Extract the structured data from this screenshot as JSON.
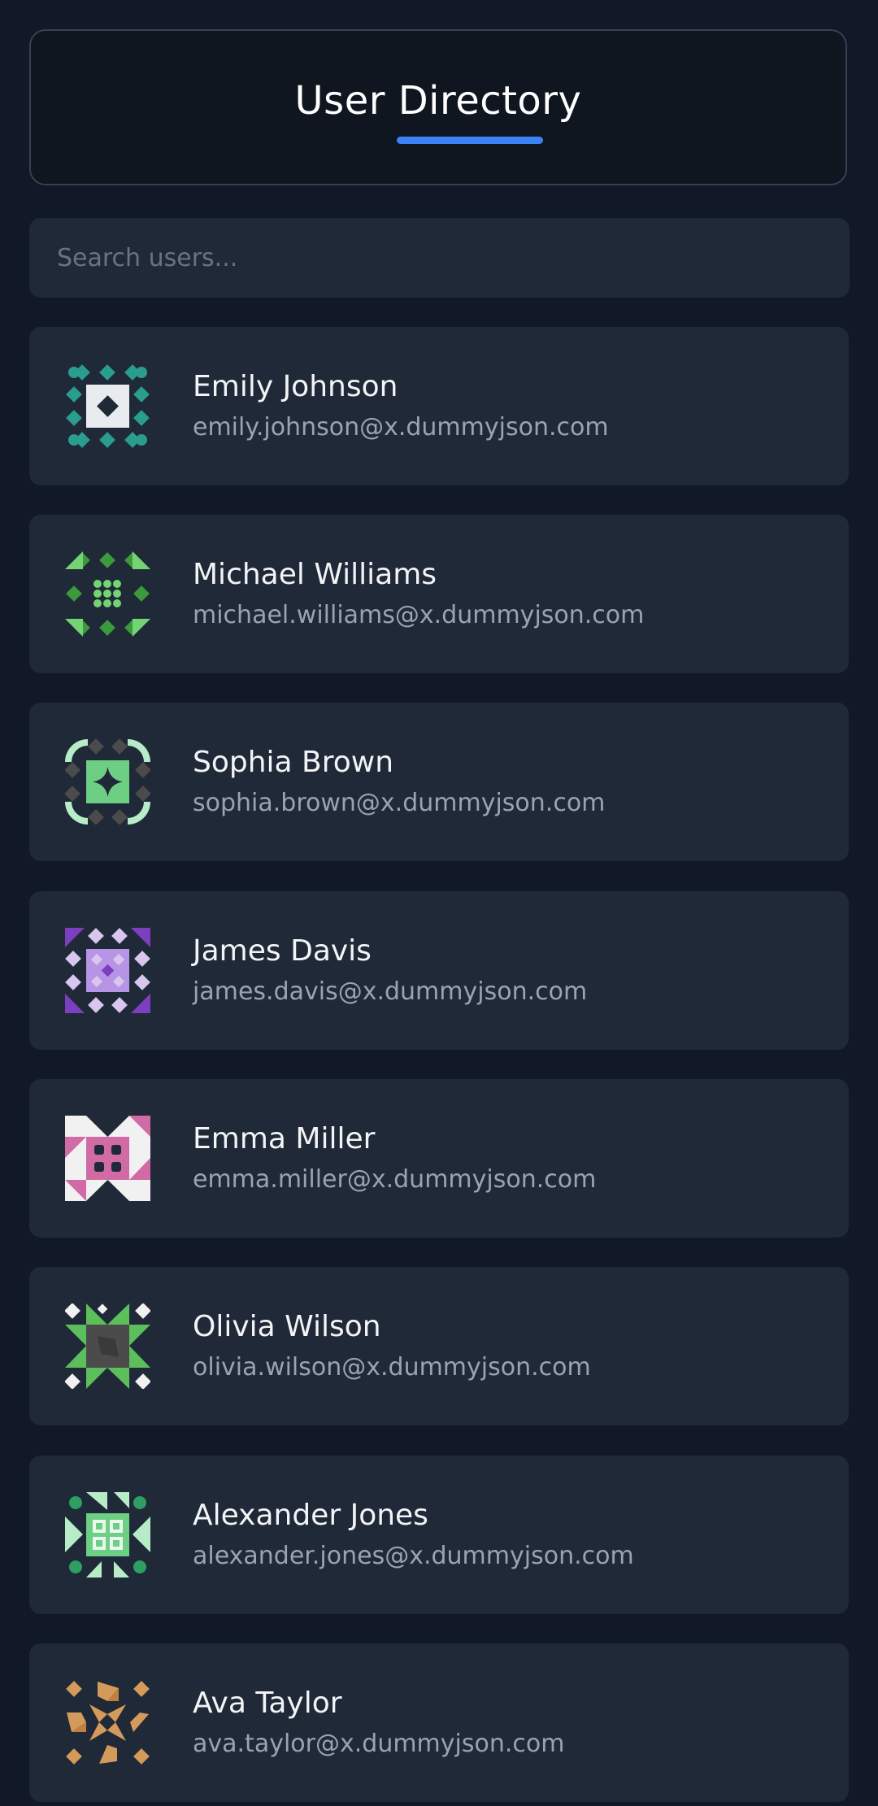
{
  "header": {
    "title": "User Directory"
  },
  "search": {
    "placeholder": "Search users..."
  },
  "users": [
    {
      "name": "Emily Johnson",
      "email": "emily.johnson@x.dummyjson.com",
      "avatar": {
        "fg": "#2a9d8f",
        "alt": "#e9ecef",
        "icon": "identicon-avatar"
      }
    },
    {
      "name": "Michael Williams",
      "email": "michael.williams@x.dummyjson.com",
      "avatar": {
        "fg": "#3c9a3c",
        "alt": "#74d474",
        "icon": "identicon-avatar"
      }
    },
    {
      "name": "Sophia Brown",
      "email": "sophia.brown@x.dummyjson.com",
      "avatar": {
        "fg": "#4b4b4b",
        "alt": "#6ccf83",
        "icon": "identicon-avatar"
      }
    },
    {
      "name": "James Davis",
      "email": "james.davis@x.dummyjson.com",
      "avatar": {
        "fg": "#7b3fbf",
        "alt": "#d8c6ef",
        "icon": "identicon-avatar"
      }
    },
    {
      "name": "Emma Miller",
      "email": "emma.miller@x.dummyjson.com",
      "avatar": {
        "fg": "#d16ba5",
        "alt": "#f1f1f1",
        "icon": "identicon-avatar"
      }
    },
    {
      "name": "Olivia Wilson",
      "email": "olivia.wilson@x.dummyjson.com",
      "avatar": {
        "fg": "#5cbf5c",
        "alt": "#4b4b4b",
        "icon": "identicon-avatar"
      }
    },
    {
      "name": "Alexander Jones",
      "email": "alexander.jones@x.dummyjson.com",
      "avatar": {
        "fg": "#2e9e63",
        "alt": "#b8ecc8",
        "icon": "identicon-avatar"
      }
    },
    {
      "name": "Ava Taylor",
      "email": "ava.taylor@x.dummyjson.com",
      "avatar": {
        "fg": "#d49a5a",
        "alt": "#c08040",
        "icon": "identicon-avatar"
      }
    }
  ]
}
